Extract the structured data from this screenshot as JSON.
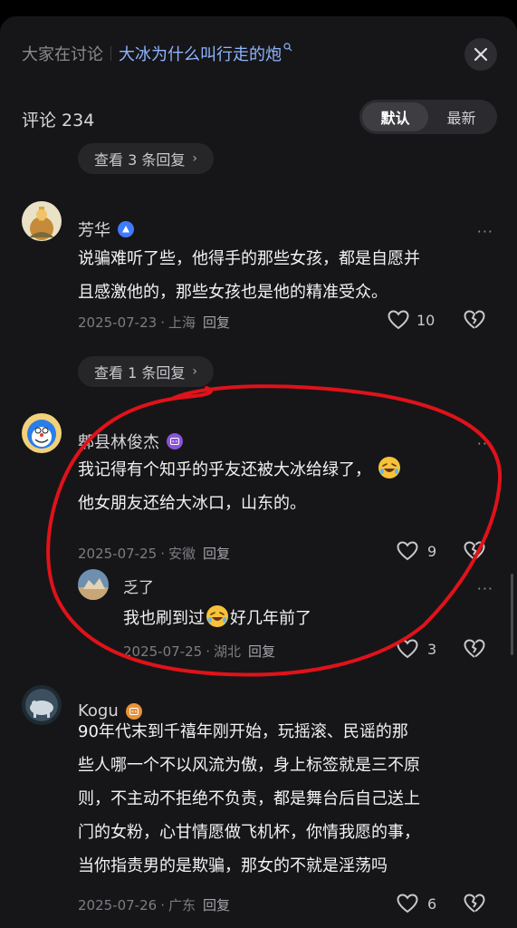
{
  "header": {
    "topic_label": "大家在讨论",
    "topic_link": "大冰为什么叫行走的炮",
    "topic_search_icon": "search-icon"
  },
  "comment_count": "评论 234",
  "sort": {
    "default_label": "默认",
    "latest_label": "最新"
  },
  "expand": {
    "first": "查看 3 条回复",
    "second": "查看 1 条回复",
    "chevron": "›"
  },
  "comments": [
    {
      "user": "芳华",
      "badge_icon": "verified-triangle-icon",
      "lines": [
        "说骗难听了些，他得手的那些女孩，都是自愿并",
        "且感激他的，那些女孩也是他的精准受众。"
      ],
      "date": "2025-07-23",
      "location": "上海",
      "reply_label": "回复",
      "likes": "10"
    },
    {
      "user": "郫县林俊杰",
      "badge_icon": "level-badge-icon",
      "lines": [
        "我记得有个知乎的乎友还被大冰给绿了，",
        "他女朋友还给大冰口，山东的。"
      ],
      "date": "2025-07-25",
      "location": "安徽",
      "reply_label": "回复",
      "likes": "9"
    },
    {
      "user": "乏了",
      "line_part1": "我也刷到过",
      "line_part2": "好几年前了",
      "date": "2025-07-25",
      "location": "湖北",
      "reply_label": "回复",
      "likes": "3"
    },
    {
      "user": "Kogu",
      "badge_icon": "level-badge-icon",
      "lines": [
        "90年代末到千禧年刚开始，玩摇滚、民谣的那",
        "些人哪一个不以风流为傲，身上标签就是三不原",
        "则，不主动不拒绝不负责，都是舞台后自己送上",
        "门的女粉，心甘情愿做飞机杯，你情我愿的事，",
        "当你指责男的是欺骗，那女的不就是淫荡吗"
      ],
      "date": "2025-07-26",
      "location": "广东",
      "reply_label": "回复",
      "likes": "6"
    }
  ],
  "colors": {
    "sheet_bg": "#161618",
    "link_blue": "#8fb4ff",
    "annotation_red": "#e0121a"
  }
}
